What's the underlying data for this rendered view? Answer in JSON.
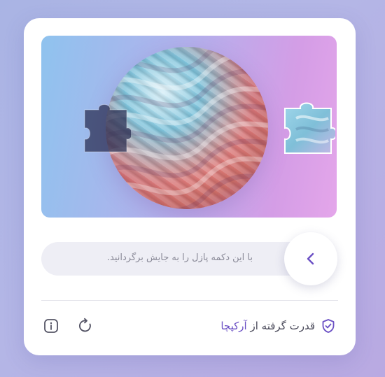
{
  "captcha": {
    "slider_hint": "با این دکمه پازل را به جایش برگردانید.",
    "branding_prefix": "قدرت گرفته از",
    "brand_name": "آرکپچا"
  },
  "icons": {
    "slider_arrow": "chevron-left-icon",
    "info": "info-icon",
    "refresh": "refresh-icon",
    "brand": "shield-check-icon"
  },
  "colors": {
    "accent": "#6a4fc4",
    "card": "#ffffff",
    "track": "#eeeef5"
  }
}
